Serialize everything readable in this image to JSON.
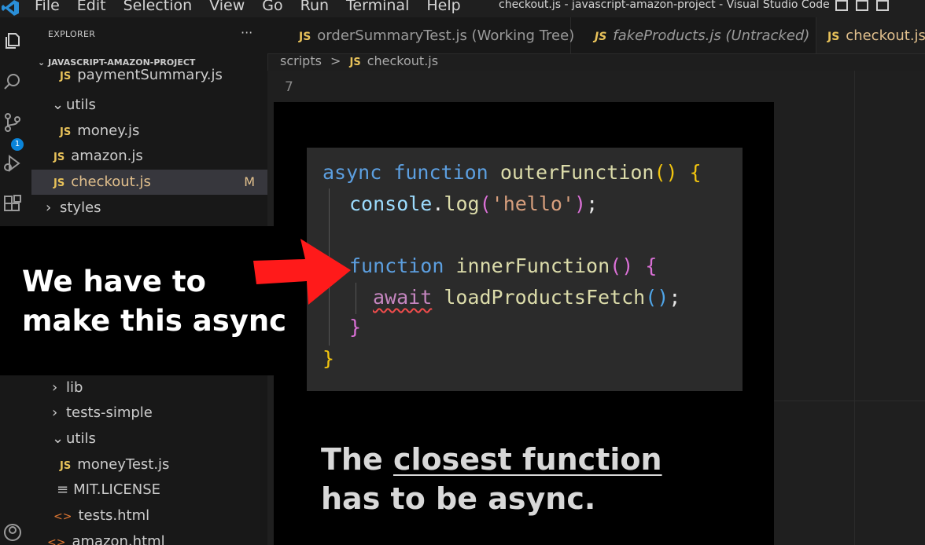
{
  "titlebar": {
    "menu": [
      "File",
      "Edit",
      "Selection",
      "View",
      "Go",
      "Run",
      "Terminal",
      "Help"
    ],
    "window_title": "checkout.js - javascript-amazon-project - Visual Studio Code"
  },
  "activity_bar": {
    "scm_badge": "1",
    "icons": [
      "explorer-icon",
      "search-icon",
      "source-control-icon",
      "run-debug-icon",
      "extensions-icon",
      "account-icon"
    ]
  },
  "sidebar": {
    "header": "EXPLORER",
    "more": "···",
    "project": "JAVASCRIPT-AMAZON-PROJECT",
    "tree_top": [
      {
        "type": "js",
        "label": "paymentSummary.js"
      },
      {
        "type": "folder",
        "label": "utils"
      },
      {
        "type": "js",
        "label": "money.js"
      },
      {
        "type": "js",
        "label": "amazon.js"
      },
      {
        "type": "js",
        "label": "checkout.js",
        "status": "M"
      },
      {
        "type": "folder-closed",
        "label": "styles"
      }
    ],
    "tree_bottom": [
      {
        "type": "folder-closed",
        "label": "lib"
      },
      {
        "type": "folder-closed",
        "label": "tests-simple"
      },
      {
        "type": "folder",
        "label": "utils"
      },
      {
        "type": "js",
        "label": "moneyTest.js"
      },
      {
        "type": "license",
        "label": "MIT.LICENSE"
      },
      {
        "type": "html",
        "label": "tests.html"
      },
      {
        "type": "html",
        "label": "amazon.html"
      }
    ],
    "js_tag": "JS"
  },
  "tabs": [
    {
      "label": "orderSummaryTest.js (Working Tree)",
      "italic": false
    },
    {
      "label": "fakeProducts.js (Untracked)",
      "italic": true
    },
    {
      "label": "checkout.js",
      "active": true
    }
  ],
  "breadcrumb": {
    "folder": "scripts",
    "sep": ">",
    "file": "checkout.js"
  },
  "editor": {
    "line_number": "7"
  },
  "code": {
    "line1": {
      "kw1": "async",
      "kw2": "function",
      "name": "outerFunction",
      "parens": "()",
      "brace": "{"
    },
    "line2": {
      "obj": "console",
      "dot": ".",
      "method": "log",
      "open": "(",
      "arg": "'hello'",
      "close": ")",
      "semi": ";"
    },
    "line4": {
      "kw": "function",
      "name": "innerFunction",
      "parens": "()",
      "brace": "{"
    },
    "line5": {
      "kw": "await",
      "call": "loadProductsFetch",
      "parens": "()",
      "semi": ";"
    },
    "line6": {
      "brace": "}"
    },
    "line7": {
      "brace": "}"
    }
  },
  "captions": {
    "left_line1": "We have to",
    "left_line2": "make this async",
    "bottom_line1_pre": "The ",
    "bottom_line1_u": "closest function",
    "bottom_line2": "has to be async."
  },
  "colors": {
    "arrow": "#ff1a1a",
    "keyword": "#5c9fe0",
    "function": "#dcdcaa",
    "badge": "#0a84d9"
  }
}
